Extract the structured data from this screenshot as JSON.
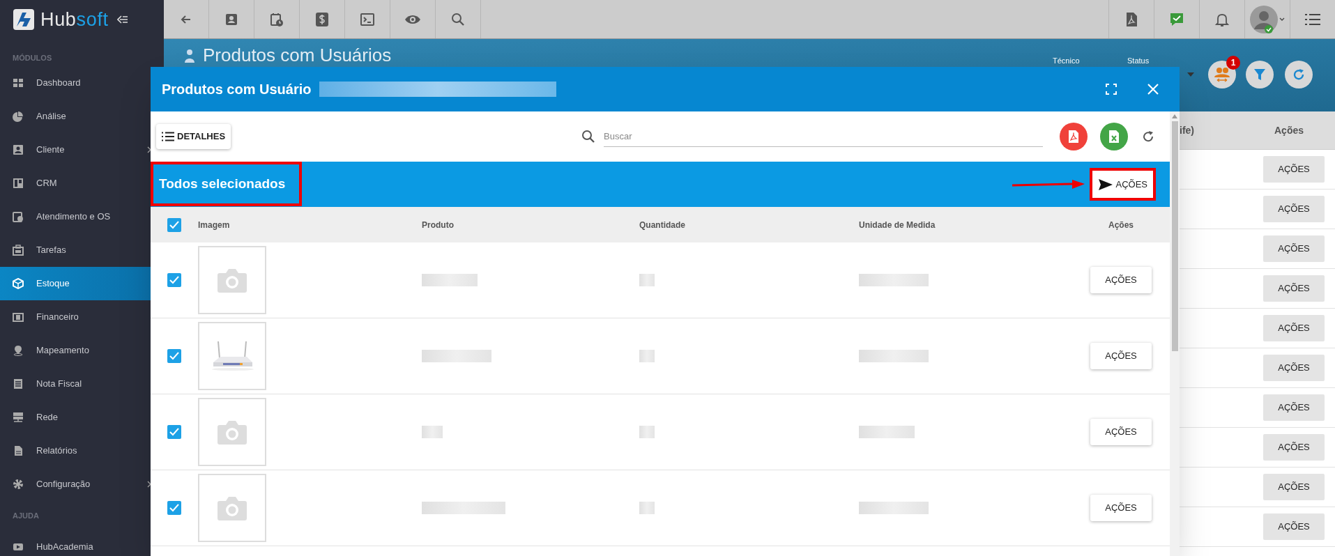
{
  "brand": {
    "part_1": "Hub",
    "part_2": "soft"
  },
  "sidebar": {
    "sections": [
      {
        "title": "MÓDULOS",
        "items": [
          {
            "label": "Dashboard",
            "selected": false,
            "has_submenu": false
          },
          {
            "label": "Análise",
            "selected": false,
            "has_submenu": false
          },
          {
            "label": "Cliente",
            "selected": false,
            "has_submenu": true
          },
          {
            "label": "CRM",
            "selected": false,
            "has_submenu": false
          },
          {
            "label": "Atendimento e OS",
            "selected": false,
            "has_submenu": false
          },
          {
            "label": "Tarefas",
            "selected": false,
            "has_submenu": false
          },
          {
            "label": "Estoque",
            "selected": true,
            "has_submenu": false
          },
          {
            "label": "Financeiro",
            "selected": false,
            "has_submenu": false
          },
          {
            "label": "Mapeamento",
            "selected": false,
            "has_submenu": false
          },
          {
            "label": "Nota Fiscal",
            "selected": false,
            "has_submenu": false
          },
          {
            "label": "Rede",
            "selected": false,
            "has_submenu": false
          },
          {
            "label": "Relatórios",
            "selected": false,
            "has_submenu": false
          },
          {
            "label": "Configuração",
            "selected": false,
            "has_submenu": true
          }
        ]
      },
      {
        "title": "AJUDA",
        "items": [
          {
            "label": "HubAcademia",
            "selected": false,
            "has_submenu": false
          }
        ]
      }
    ]
  },
  "page": {
    "title": "Produtos com Usuários",
    "filters": [
      {
        "label": "Técnico"
      },
      {
        "label": "Status"
      }
    ],
    "badge": "1",
    "table": {
      "columns": [
        "ife)",
        "Ações"
      ],
      "rows": [
        {
          "action": "AÇÕES"
        },
        {
          "action": "AÇÕES"
        },
        {
          "action": "AÇÕES"
        },
        {
          "action": "AÇÕES"
        },
        {
          "action": "AÇÕES"
        },
        {
          "action": "AÇÕES"
        },
        {
          "action": "AÇÕES"
        },
        {
          "action": "AÇÕES"
        },
        {
          "action": "AÇÕES"
        },
        {
          "action": "AÇÕES"
        }
      ]
    }
  },
  "modal": {
    "title": "Produtos com Usuário",
    "title_redacted": true,
    "toolbar": {
      "details_button": "DETALHES",
      "search": {
        "placeholder": "Buscar"
      }
    },
    "selection_bar": {
      "label": "Todos selecionados",
      "action": "AÇÕES",
      "highlighted": true,
      "arrow": true
    },
    "table": {
      "all_checked": true,
      "columns": [
        "Imagem",
        "Produto",
        "Quantidade",
        "Unidade de Medida",
        "Ações"
      ],
      "rows": [
        {
          "checked": true,
          "kind": "placeholder",
          "redacted": true,
          "action": "AÇÕES"
        },
        {
          "checked": true,
          "kind": "picture",
          "redacted": true,
          "action": "AÇÕES"
        },
        {
          "checked": true,
          "kind": "placeholder",
          "redacted": true,
          "action": "AÇÕES"
        },
        {
          "checked": true,
          "kind": "placeholder",
          "redacted": true,
          "action": "AÇÕES"
        }
      ]
    }
  }
}
